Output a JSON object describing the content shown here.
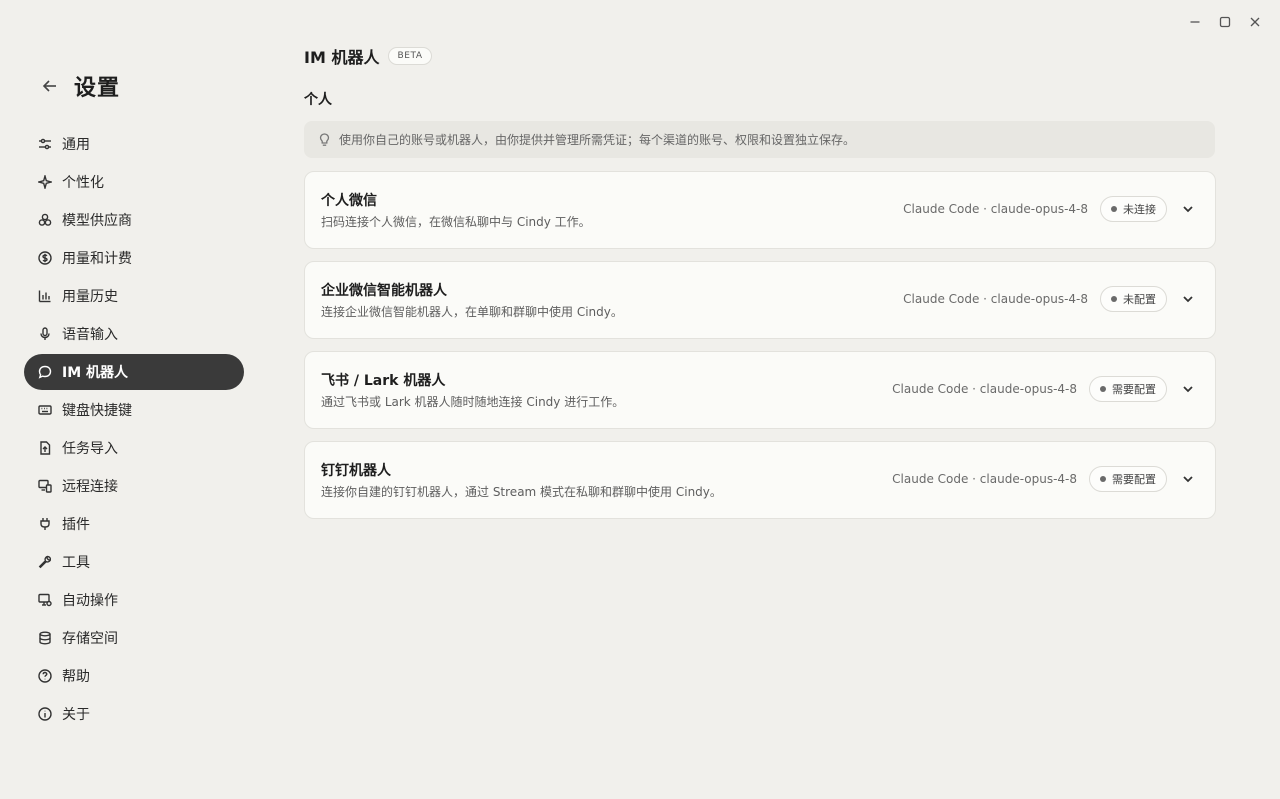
{
  "sidebar": {
    "title": "设置",
    "items": [
      {
        "label": "通用",
        "icon": "sliders-icon"
      },
      {
        "label": "个性化",
        "icon": "sparkle-icon"
      },
      {
        "label": "模型供应商",
        "icon": "cubes-icon"
      },
      {
        "label": "用量和计费",
        "icon": "dollar-icon"
      },
      {
        "label": "用量历史",
        "icon": "bar-chart-icon"
      },
      {
        "label": "语音输入",
        "icon": "microphone-icon"
      },
      {
        "label": "IM 机器人",
        "icon": "chat-bubble-icon",
        "active": true
      },
      {
        "label": "键盘快捷键",
        "icon": "keyboard-icon"
      },
      {
        "label": "任务导入",
        "icon": "file-upload-icon"
      },
      {
        "label": "远程连接",
        "icon": "remote-devices-icon"
      },
      {
        "label": "插件",
        "icon": "plug-icon"
      },
      {
        "label": "工具",
        "icon": "wrench-icon"
      },
      {
        "label": "自动操作",
        "icon": "monitor-gear-icon"
      },
      {
        "label": "存储空间",
        "icon": "database-icon"
      },
      {
        "label": "帮助",
        "icon": "help-circle-icon"
      },
      {
        "label": "关于",
        "icon": "info-icon"
      }
    ]
  },
  "main": {
    "title": "IM 机器人",
    "badge": "BETA",
    "section": "个人",
    "hint": "使用你自己的账号或机器人，由你提供并管理所需凭证；每个渠道的账号、权限和设置独立保存。",
    "cards": [
      {
        "title": "个人微信",
        "desc": "扫码连接个人微信，在微信私聊中与 Cindy 工作。",
        "model": "Claude Code · claude-opus-4-8",
        "status": "未连接"
      },
      {
        "title": "企业微信智能机器人",
        "desc": "连接企业微信智能机器人，在单聊和群聊中使用 Cindy。",
        "model": "Claude Code · claude-opus-4-8",
        "status": "未配置"
      },
      {
        "title": "飞书 / Lark 机器人",
        "desc": "通过飞书或 Lark 机器人随时随地连接 Cindy 进行工作。",
        "model": "Claude Code · claude-opus-4-8",
        "status": "需要配置"
      },
      {
        "title": "钉钉机器人",
        "desc": "连接你自建的钉钉机器人，通过 Stream 模式在私聊和群聊中使用 Cindy。",
        "model": "Claude Code · claude-opus-4-8",
        "status": "需要配置"
      }
    ]
  }
}
